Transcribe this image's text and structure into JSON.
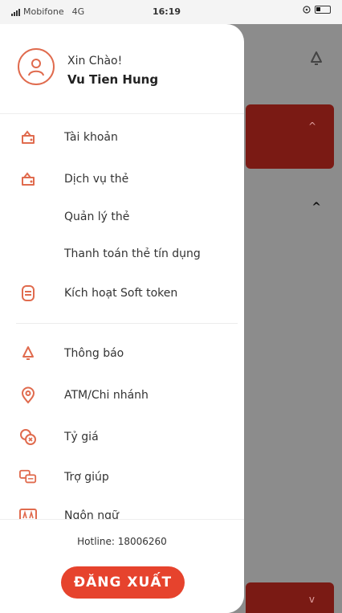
{
  "status_bar": {
    "carrier": "Mobifone",
    "network": "4G",
    "time": "16:19"
  },
  "profile": {
    "greeting": "Xin Chào!",
    "name": "Vu Tien Hung"
  },
  "menu": {
    "items": [
      {
        "label": "Tài khoản",
        "icon": "wallet-icon"
      },
      {
        "label": "Dịch vụ thẻ",
        "icon": "wallet-icon"
      },
      {
        "label": "Quản lý thẻ",
        "icon": ""
      },
      {
        "label": "Thanh toán thẻ tín dụng",
        "icon": ""
      },
      {
        "label": "Kích hoạt Soft token",
        "icon": "token-icon"
      },
      {
        "label": "Thông báo",
        "icon": "bell-icon"
      },
      {
        "label": "ATM/Chi nhánh",
        "icon": "location-pin-icon"
      },
      {
        "label": "Tỷ giá",
        "icon": "exchange-rate-icon"
      },
      {
        "label": "Trợ giúp",
        "icon": "help-chat-icon"
      },
      {
        "label": "Ngôn ngữ",
        "icon": "language-icon"
      }
    ]
  },
  "footer": {
    "hotline": "Hotline: 18006260",
    "logout_label": "ĐĂNG XUẤT"
  },
  "colors": {
    "accent": "#e6432d",
    "icon": "#e06b4e",
    "dark_red": "#7a1a14"
  }
}
